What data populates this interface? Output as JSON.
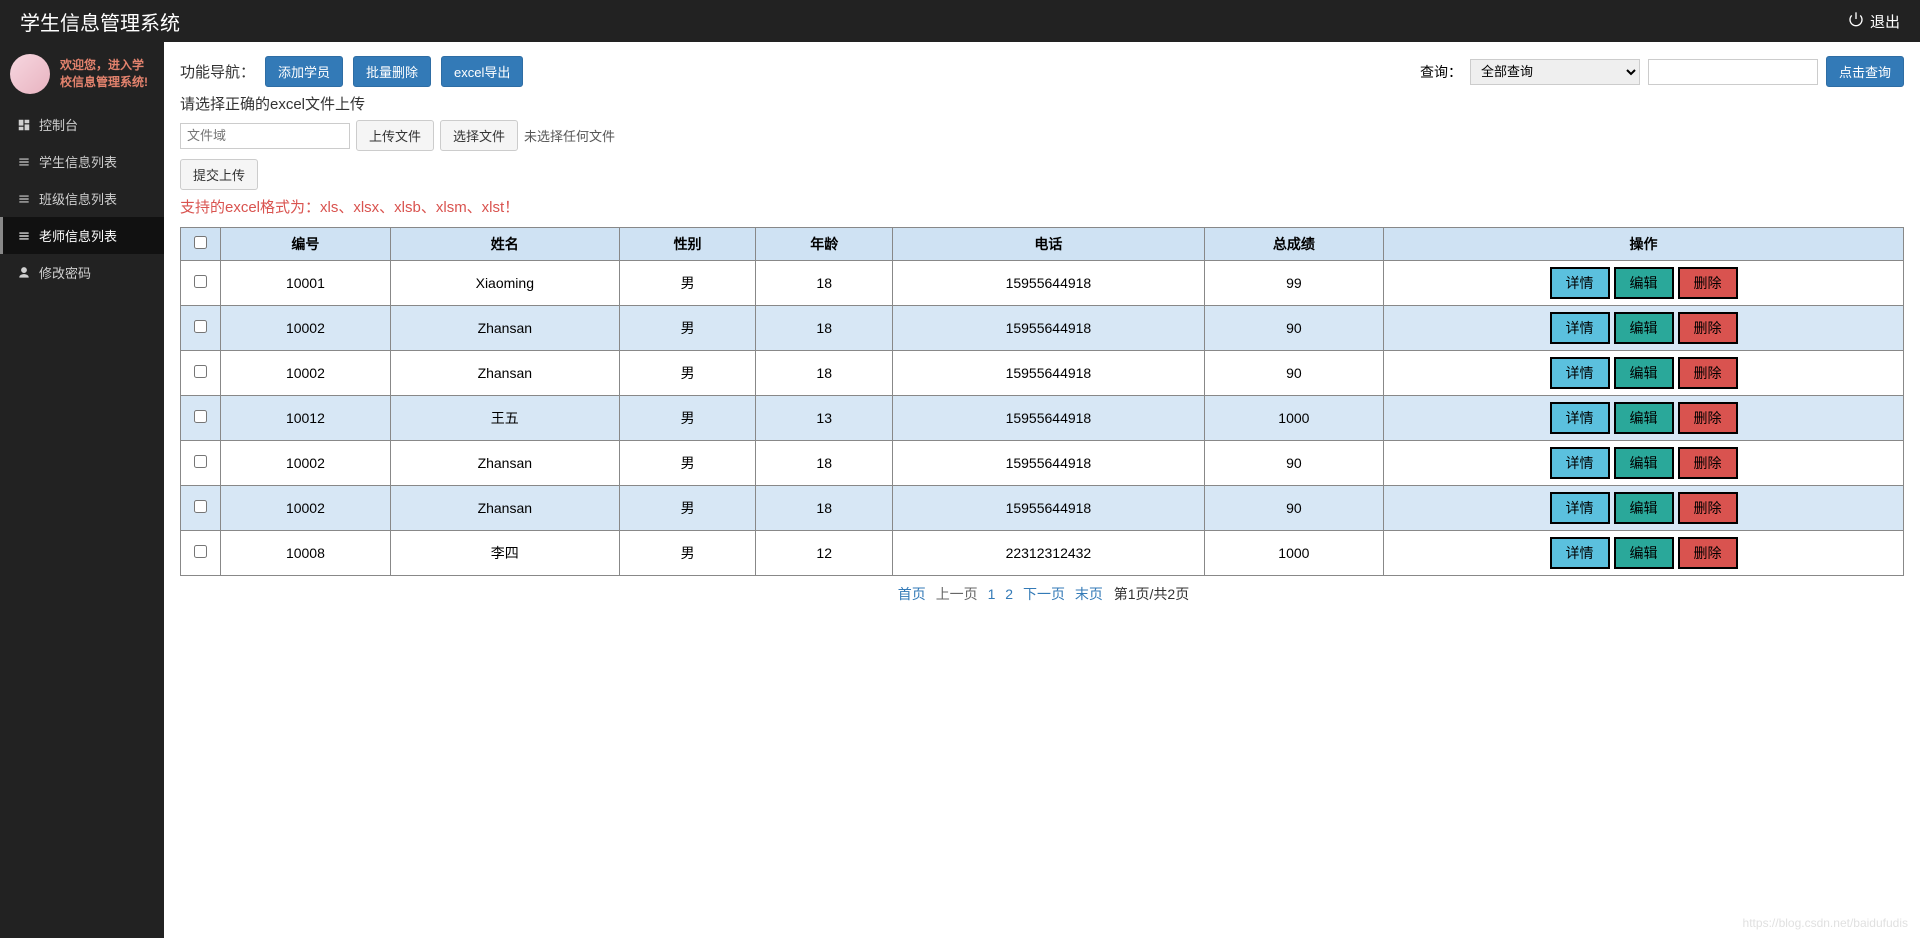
{
  "header": {
    "title": "学生信息管理系统",
    "logout": "退出"
  },
  "sidebar": {
    "welcome_line1": "欢迎您，进入学",
    "welcome_line2": "校信息管理系统!",
    "items": [
      {
        "label": "控制台",
        "active": false,
        "icon": "dashboard"
      },
      {
        "label": "学生信息列表",
        "active": false,
        "icon": "list"
      },
      {
        "label": "班级信息列表",
        "active": false,
        "icon": "list"
      },
      {
        "label": "老师信息列表",
        "active": true,
        "icon": "list"
      },
      {
        "label": "修改密码",
        "active": false,
        "icon": "user"
      }
    ]
  },
  "toolbar": {
    "nav_label": "功能导航：",
    "add_btn": "添加学员",
    "batch_delete_btn": "批量删除",
    "excel_export_btn": "excel导出",
    "search_label": "查询：",
    "search_options": [
      "全部查询"
    ],
    "search_selected": "全部查询",
    "search_input": "",
    "search_btn": "点击查询"
  },
  "upload": {
    "hint": "请选择正确的excel文件上传",
    "file_field_placeholder": "文件域",
    "upload_btn": "上传文件",
    "choose_btn": "选择文件",
    "no_file": "未选择任何文件",
    "submit_btn": "提交上传",
    "format_note": "支持的excel格式为：xls、xlsx、xlsb、xlsm、xlst！"
  },
  "table": {
    "headers": [
      "",
      "编号",
      "姓名",
      "性别",
      "年龄",
      "电话",
      "总成绩",
      "操作"
    ],
    "row_btns": {
      "detail": "详情",
      "edit": "编辑",
      "delete": "删除"
    },
    "rows": [
      {
        "id": "10001",
        "name": "Xiaoming",
        "gender": "男",
        "age": "18",
        "phone": "15955644918",
        "score": "99"
      },
      {
        "id": "10002",
        "name": "Zhansan",
        "gender": "男",
        "age": "18",
        "phone": "15955644918",
        "score": "90"
      },
      {
        "id": "10002",
        "name": "Zhansan",
        "gender": "男",
        "age": "18",
        "phone": "15955644918",
        "score": "90"
      },
      {
        "id": "10012",
        "name": "王五",
        "gender": "男",
        "age": "13",
        "phone": "15955644918",
        "score": "1000"
      },
      {
        "id": "10002",
        "name": "Zhansan",
        "gender": "男",
        "age": "18",
        "phone": "15955644918",
        "score": "90"
      },
      {
        "id": "10002",
        "name": "Zhansan",
        "gender": "男",
        "age": "18",
        "phone": "15955644918",
        "score": "90"
      },
      {
        "id": "10008",
        "name": "李四",
        "gender": "男",
        "age": "12",
        "phone": "22312312432",
        "score": "1000"
      }
    ]
  },
  "pager": {
    "first": "首页",
    "prev": "上一页",
    "pages": [
      "1",
      "2"
    ],
    "next": "下一页",
    "last": "末页",
    "info": "第1页/共2页"
  },
  "watermark": "https://blog.csdn.net/baidufudis"
}
